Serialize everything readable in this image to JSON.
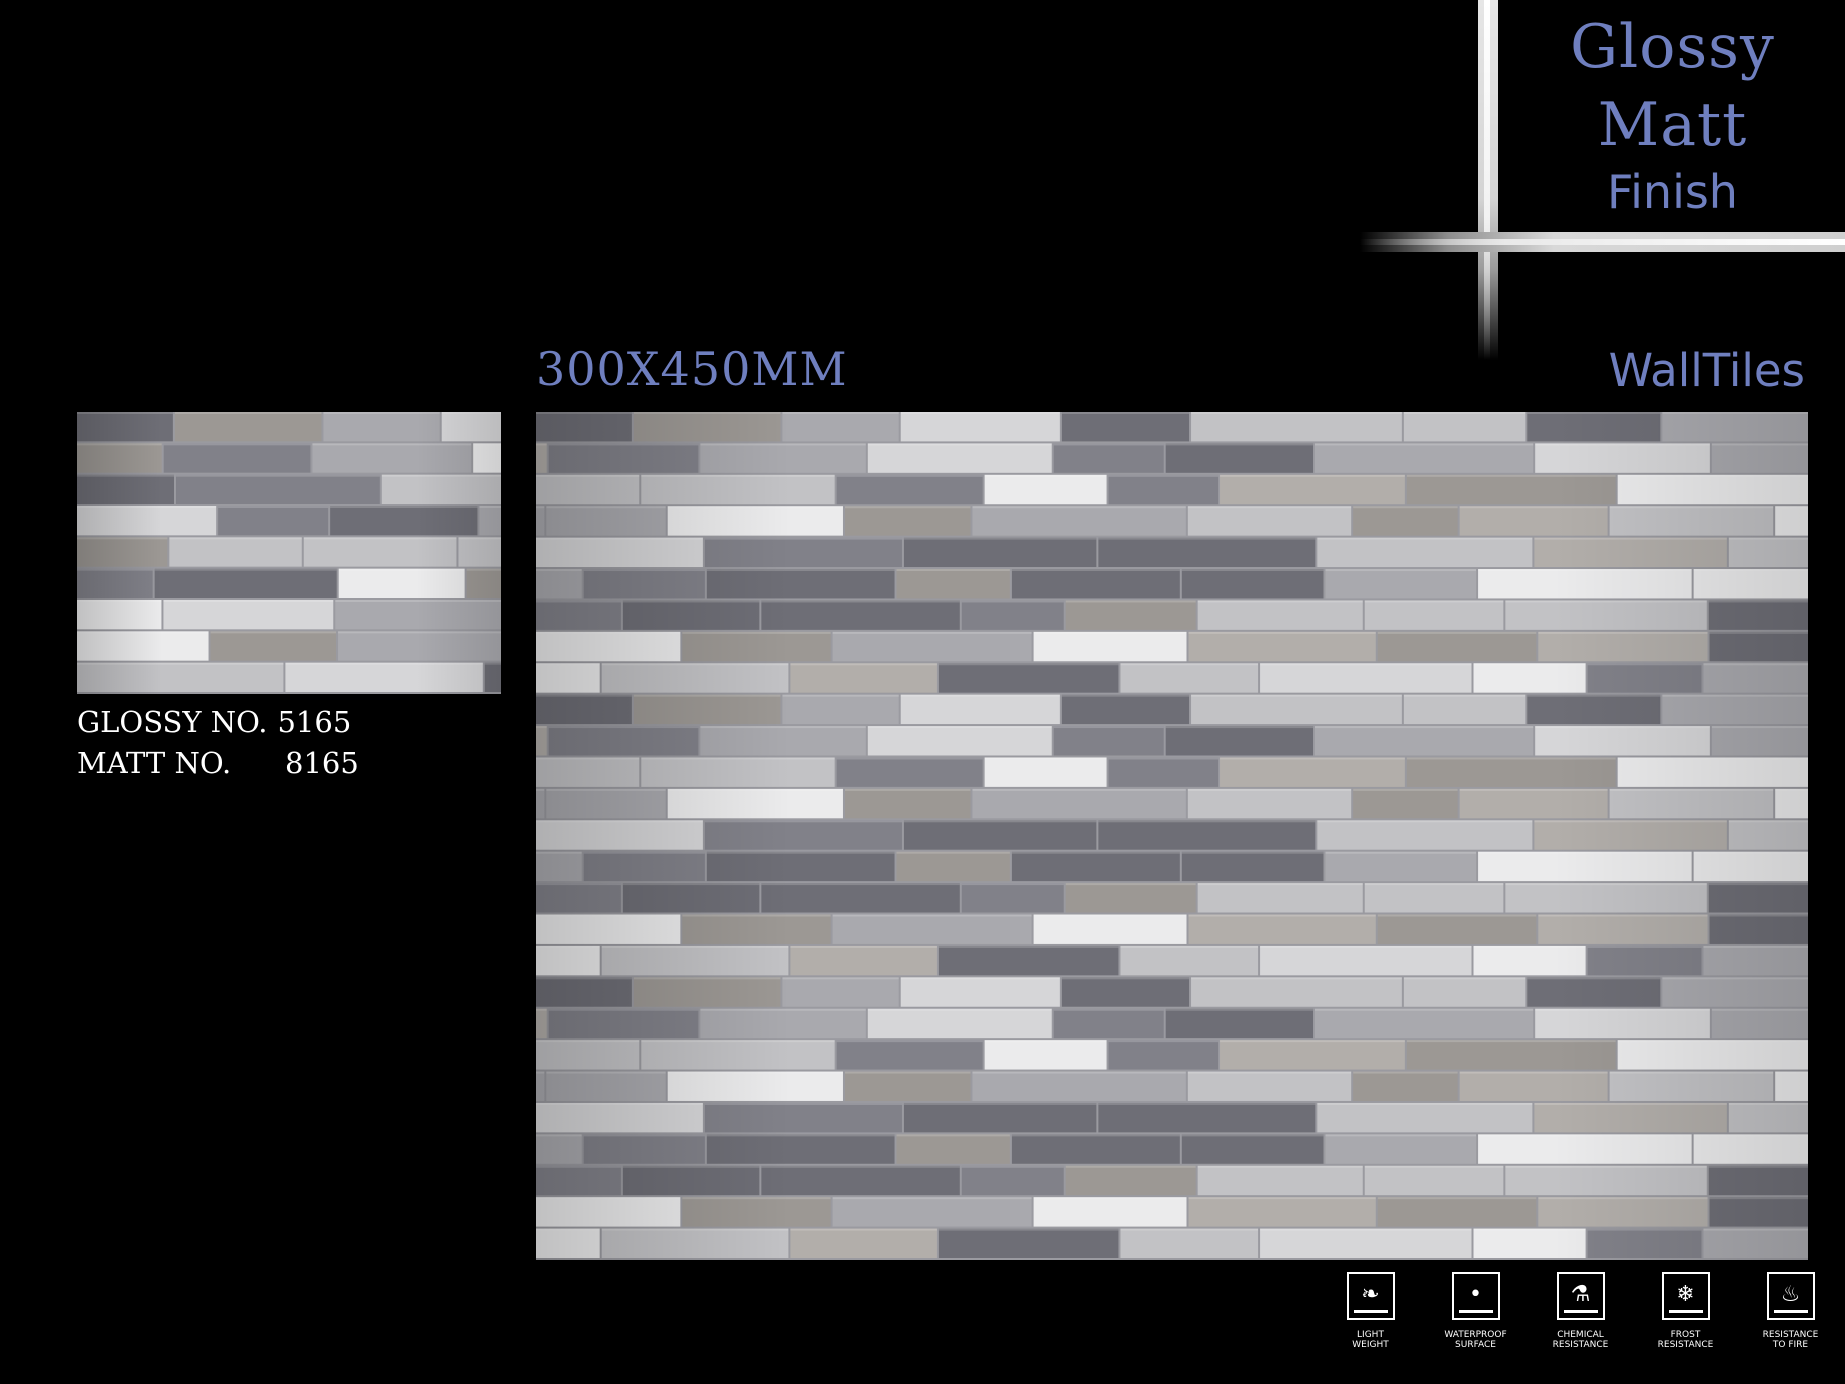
{
  "finish": {
    "line1": "Glossy",
    "line2": "Matt",
    "line3": "Finish"
  },
  "size_label": "300X450MM",
  "category_label": "WallTiles",
  "codes": {
    "glossy_label": "GLOSSY NO.",
    "glossy_number": "5165",
    "matt_label": "MATT NO.",
    "matt_number": "8165"
  },
  "features": [
    {
      "icon": "feather-icon",
      "glyph": "❧",
      "line1": "LIGHT",
      "line2": "WEIGHT"
    },
    {
      "icon": "water-drop-icon",
      "glyph": "•",
      "line1": "WATERPROOF",
      "line2": "SURFACE"
    },
    {
      "icon": "flask-icon",
      "glyph": "⚗",
      "line1": "CHEMICAL",
      "line2": "RESISTANCE"
    },
    {
      "icon": "snowflake-icon",
      "glyph": "❄",
      "line1": "FROST",
      "line2": "RESISTANCE"
    },
    {
      "icon": "flame-icon",
      "glyph": "♨",
      "line1": "RESISTANCE",
      "line2": "TO FIRE"
    }
  ],
  "colors": {
    "accent": "#6f7fbf",
    "background": "#000000",
    "text": "#ffffff",
    "tile_palette": [
      "#6e6e76",
      "#818189",
      "#a9a9ae",
      "#c2c2c5",
      "#d6d6d8",
      "#ebebec",
      "#b2aeaa",
      "#9c9894"
    ]
  }
}
